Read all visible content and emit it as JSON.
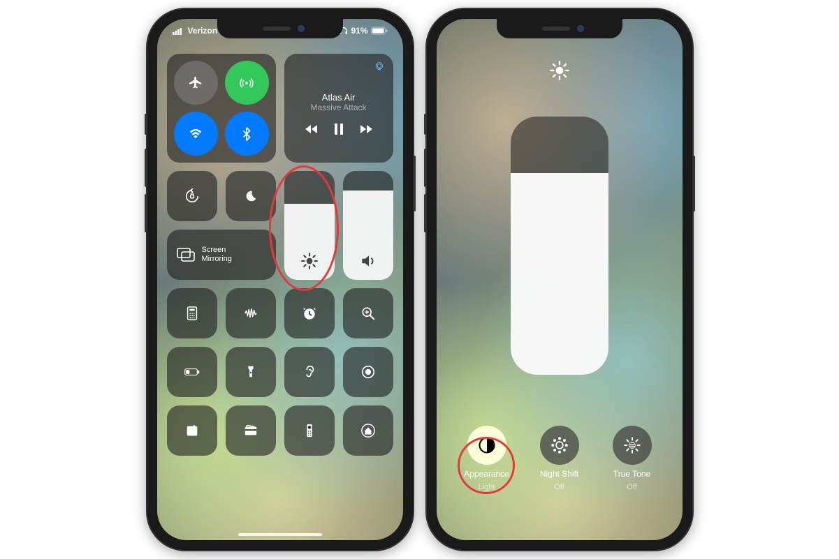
{
  "status": {
    "carrier": "Verizon",
    "battery_pct": "91%"
  },
  "music": {
    "song": "Atlas Air",
    "artist": "Massive Attack"
  },
  "screen_mirroring": {
    "line1": "Screen",
    "line2": "Mirroring"
  },
  "brightness_fill_pct": 70,
  "volume_fill_pct": 82,
  "detail": {
    "brightness_fill_pct": 78,
    "items": [
      {
        "label": "Appearance",
        "sub": "Light"
      },
      {
        "label": "Night Shift",
        "sub": "Off"
      },
      {
        "label": "True Tone",
        "sub": "Off"
      }
    ]
  }
}
